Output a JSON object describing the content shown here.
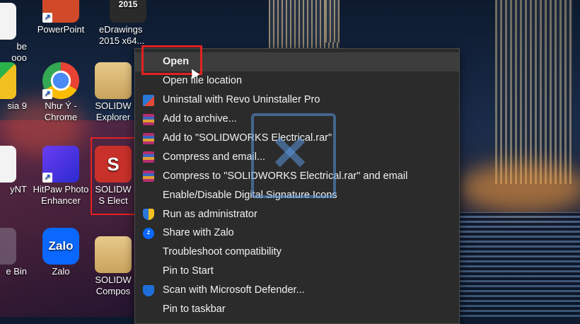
{
  "desktop": {
    "icons": [
      {
        "label": "be",
        "label2": "ooo"
      },
      {
        "label": "PowerPoint"
      },
      {
        "label": "2015",
        "sub": "eDrawings",
        "sub2": "2015 x64..."
      },
      {
        "label": "sia 9"
      },
      {
        "label": "Như Ý -",
        "label2": "Chrome"
      },
      {
        "label": "SOLIDW",
        "label2": "Explorer"
      },
      {
        "label": "yNT"
      },
      {
        "label": "HitPaw Photo",
        "label2": "Enhancer"
      },
      {
        "label": "SOLIDW",
        "label2": "S Elect"
      },
      {
        "label": "Zalo",
        "icon_text": "Zalo"
      },
      {
        "label": "e Bin"
      },
      {
        "label": "SOLIDW",
        "label2": "Compos"
      }
    ]
  },
  "context_menu": {
    "items": [
      {
        "label": "Open",
        "icon": "none"
      },
      {
        "label": "Open file location",
        "icon": "none"
      },
      {
        "label": "Uninstall with Revo Uninstaller Pro",
        "icon": "revo-uninstaller-icon"
      },
      {
        "label": "Add to archive...",
        "icon": "winrar-icon"
      },
      {
        "label": "Add to \"SOLIDWORKS Electrical.rar\"",
        "icon": "winrar-icon"
      },
      {
        "label": "Compress and email...",
        "icon": "winrar-icon"
      },
      {
        "label": "Compress to \"SOLIDWORKS Electrical.rar\" and email",
        "icon": "winrar-icon"
      },
      {
        "label": "Enable/Disable Digital Signature Icons",
        "icon": "none"
      },
      {
        "label": "Run as administrator",
        "icon": "uac-shield-icon"
      },
      {
        "label": "Share with Zalo",
        "icon": "zalo-icon"
      },
      {
        "label": "Troubleshoot compatibility",
        "icon": "none"
      },
      {
        "label": "Pin to Start",
        "icon": "none"
      },
      {
        "label": "Scan with Microsoft Defender...",
        "icon": "defender-icon"
      },
      {
        "label": "Pin to taskbar",
        "icon": "none"
      }
    ]
  },
  "colors": {
    "menu_bg": "#2b2b2b",
    "menu_text": "#f2f2f2",
    "highlight_red": "#e32222"
  }
}
